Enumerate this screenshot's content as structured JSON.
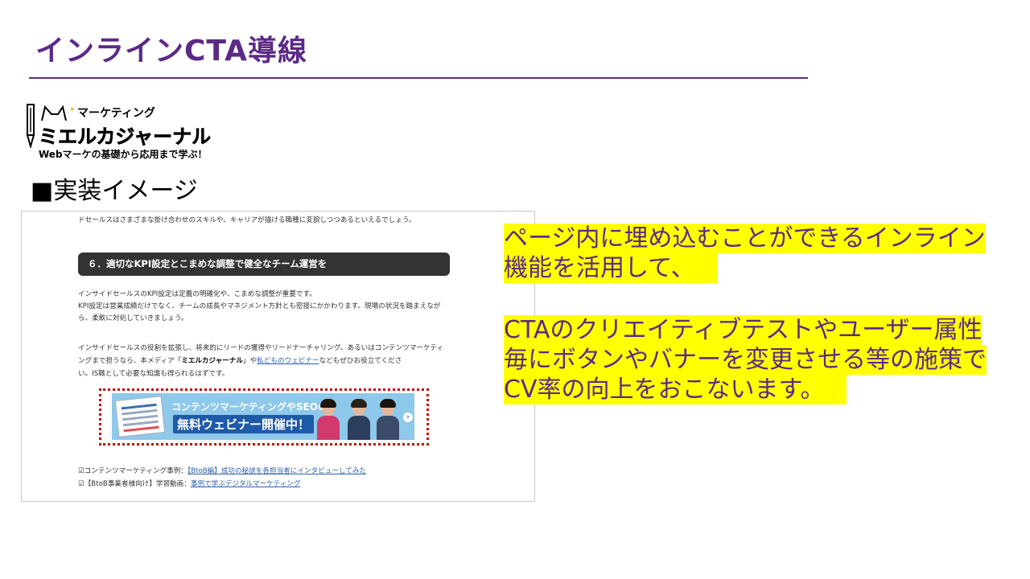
{
  "slide": {
    "title": "インラインCTA導線",
    "impl_heading": "■実装イメージ"
  },
  "logo": {
    "sub": "マーケティング",
    "main": "ミエルカジャーナル",
    "tagline": "Webマーケの基礎から応用まで学ぶ！"
  },
  "screenshot": {
    "top_line": "ドセールスはさまざまな掛け合わせのスキルや、キャリアが描ける職種に変貌しつつあるといえるでしょう。",
    "section_heading": "６．適切なKPI設定とこまめな調整で健全なチーム運営を",
    "para1": [
      "インサイドセールスのKPI設定は定義の明確化や、こまめな調整が重要です。",
      "KPI設定は営業成績だけでなく、チームの成長やマネジメント方針とも密接にかかわります。現場の状況を踏まえなが",
      "ら、柔軟に対処していきましょう。"
    ],
    "para2_line1": "インサイドセールスの役割を拡張し、将来的にリードの獲得やリードナーチャリング、あるいはコンテンツマーケティ",
    "para2_line2_a": "ングまで担うなら、本メディア「",
    "para2_line2_bold": "ミエルカジャーナル",
    "para2_line2_b": "」や",
    "para2_line2_link": "私どものウェビナー",
    "para2_line2_c": "などもぜひお役立てくださ",
    "para2_line3": "い。IS職として必要な知識も得られるはずです。",
    "banner": {
      "line1": "コンテンツマーケティングやSEOの",
      "line2": "無料ウェビナー開催中！",
      "arrow": "›"
    },
    "related1_prefix": "☑コンテンツマーケティング事例：",
    "related1_link": "【BtoB編】成功の秘訣を各担当者にインタビューしてみた",
    "related2_prefix": "☑【BtoB事業者様向け】学習動画：",
    "related2_link": "事例で学ぶデジタルマーケティング"
  },
  "notes": {
    "block1": [
      "ページ内に埋め込むことができるインライン",
      "機能を活用して、"
    ],
    "block2": [
      "CTAのクリエイティブテストやユーザー属性",
      "毎にボタンやバナーを変更させる等の施策で",
      "CV率の向上をおこないます。"
    ]
  },
  "colors": {
    "title": "#5b2a86",
    "highlight": "#ffff00",
    "banner_bg": "#8ec8ea",
    "frame": "#cc0000"
  }
}
